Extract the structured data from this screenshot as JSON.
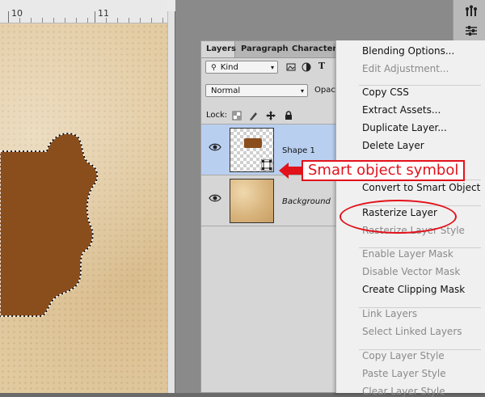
{
  "ruler": {
    "label_10": "10",
    "label_11": "11"
  },
  "panel": {
    "tabs": [
      "Layers",
      "Paragraph",
      "Character"
    ],
    "filter_kind": "Kind",
    "blend_mode": "Normal",
    "opacity_label": "Opac",
    "lock_label": "Lock:",
    "layers": [
      {
        "name": "Shape 1",
        "selected": true
      },
      {
        "name": "Background",
        "selected": false
      }
    ]
  },
  "context_menu": {
    "groups": [
      [
        {
          "label": "Blending Options...",
          "enabled": true
        },
        {
          "label": "Edit Adjustment...",
          "enabled": false
        }
      ],
      [
        {
          "label": "Copy CSS",
          "enabled": true
        },
        {
          "label": "Extract Assets...",
          "enabled": true
        },
        {
          "label": "Duplicate Layer...",
          "enabled": true
        },
        {
          "label": "Delete Layer",
          "enabled": true
        }
      ],
      [
        {
          "label": "Convert to Smart Object",
          "enabled": true
        }
      ],
      [
        {
          "label": "Rasterize Layer",
          "enabled": true
        },
        {
          "label": "Rasterize Layer Style",
          "enabled": false
        }
      ],
      [
        {
          "label": "Enable Layer Mask",
          "enabled": false
        },
        {
          "label": "Disable Vector Mask",
          "enabled": false
        },
        {
          "label": "Create Clipping Mask",
          "enabled": true
        }
      ],
      [
        {
          "label": "Link Layers",
          "enabled": false
        },
        {
          "label": "Select Linked Layers",
          "enabled": false
        }
      ],
      [
        {
          "label": "Copy Layer Style",
          "enabled": false
        },
        {
          "label": "Paste Layer Style",
          "enabled": false
        },
        {
          "label": "Clear Layer Style",
          "enabled": false
        }
      ]
    ]
  },
  "annotation": {
    "text": "Smart object symbol"
  },
  "colors": {
    "shape_fill": "#8a4e1c",
    "annotation_red": "#e2121b",
    "selection_blue": "#b9cff0"
  }
}
